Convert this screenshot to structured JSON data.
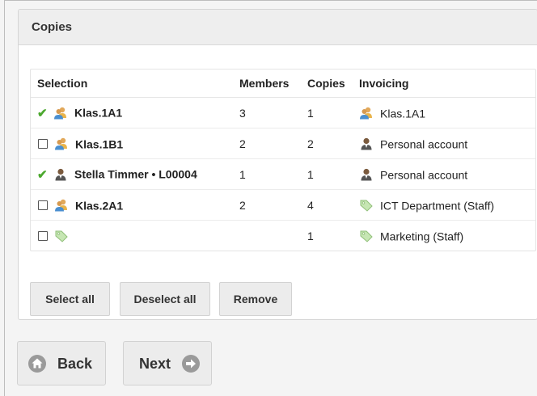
{
  "panel": {
    "title": "Copies"
  },
  "table": {
    "headers": {
      "selection": "Selection",
      "members": "Members",
      "copies": "Copies",
      "invoicing": "Invoicing"
    },
    "rows": [
      {
        "checked": true,
        "icon": "group-icon",
        "name": "Klas.1A1",
        "members": "3",
        "copies": "1",
        "invoice_icon": "group-icon",
        "invoicing": "Klas.1A1"
      },
      {
        "checked": false,
        "icon": "group-icon",
        "name": "Klas.1B1",
        "members": "2",
        "copies": "2",
        "invoice_icon": "user-icon",
        "invoicing": "Personal account"
      },
      {
        "checked": true,
        "icon": "user-icon",
        "name": "Stella Timmer • L00004",
        "members": "1",
        "copies": "1",
        "invoice_icon": "user-icon",
        "invoicing": "Personal account"
      },
      {
        "checked": false,
        "icon": "group-icon",
        "name": "Klas.2A1",
        "members": "2",
        "copies": "4",
        "invoice_icon": "tag-icon",
        "invoicing": "ICT Department (Staff)"
      },
      {
        "checked": false,
        "icon": "tag-icon",
        "name": "",
        "members": "",
        "copies": "1",
        "invoice_icon": "tag-icon",
        "invoicing": "Marketing (Staff)"
      }
    ]
  },
  "actions": {
    "select_all": "Select all",
    "deselect_all": "Deselect all",
    "remove": "Remove"
  },
  "nav": {
    "back": "Back",
    "next": "Next"
  },
  "colors": {
    "check": "#4ba82e",
    "panel_header_bg": "#eeeeee",
    "button_bg": "#ececec",
    "nav_icon": "#9a9a9a"
  }
}
